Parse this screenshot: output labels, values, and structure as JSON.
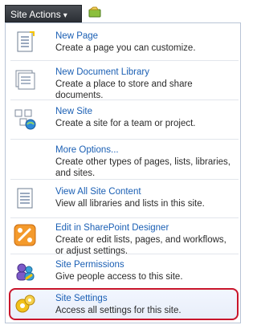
{
  "site_actions": {
    "label": "Site Actions",
    "caret": "▾"
  },
  "menu": {
    "items": [
      {
        "title": "New Page",
        "desc": "Create a page you can customize.",
        "icon": "page-icon"
      },
      {
        "title": "New Document Library",
        "desc": "Create a place to store and share documents.",
        "icon": "library-icon"
      },
      {
        "title": "New Site",
        "desc": "Create a site for a team or project.",
        "icon": "site-icon"
      },
      {
        "title": "More Options...",
        "desc": "Create other types of pages, lists, libraries, and sites.",
        "icon": ""
      },
      {
        "title": "View All Site Content",
        "desc": "View all libraries and lists in this site.",
        "icon": "content-icon"
      },
      {
        "title": "Edit in SharePoint Designer",
        "desc": "Create or edit lists, pages, and workflows, or adjust settings.",
        "icon": "designer-icon"
      },
      {
        "title": "Site Permissions",
        "desc": "Give people access to this site.",
        "icon": "permissions-icon"
      },
      {
        "title": "Site Settings",
        "desc": "Access all settings for this site.",
        "icon": "settings-gear-icon"
      }
    ]
  }
}
